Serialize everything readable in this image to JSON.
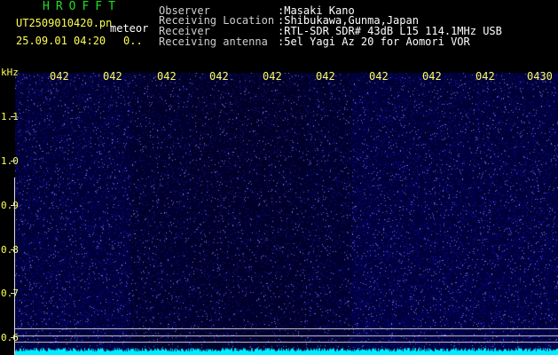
{
  "header": {
    "brand": "HROFFT",
    "file_name": "UT2509010420.pn",
    "datetime": "25.09.01 04:20",
    "ellipsis": "0..",
    "mode": "meteor",
    "fields": [
      {
        "label": "Observer",
        "value": ":Masaki Kano"
      },
      {
        "label": "Receiving Location",
        "value": ":Shibukawa,Gunma,Japan"
      },
      {
        "label": "Receiver",
        "value": ":RTL-SDR SDR# 43dB L15 114.1MHz USB"
      },
      {
        "label": "Receiving antenna",
        "value": ":5el Yagi Az 20 for Aomori VOR"
      }
    ]
  },
  "axis": {
    "unit": "kHz",
    "y_ticks": [
      "1.1",
      "1.0",
      "0.9",
      "0.8",
      "0.7",
      "0.6"
    ],
    "x_ticks": [
      "042",
      "042",
      "042",
      "042",
      "042",
      "042",
      "042",
      "042",
      "042",
      "0430"
    ]
  },
  "colors": {
    "background": "#000000",
    "waterfall_base": "#00003c",
    "signal_cyan": "#00eeff",
    "label_yellow": "#ffff55",
    "brand_green": "#22dd22"
  }
}
